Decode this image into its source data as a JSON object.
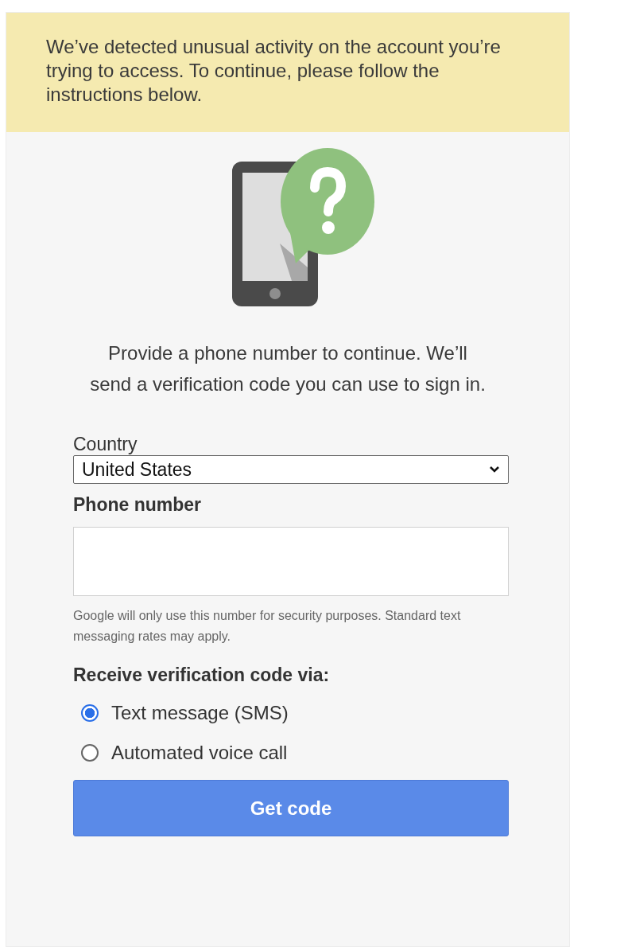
{
  "notice": "We’ve detected unusual activity on the account you’re trying to access. To continue, please follow the instructions below.",
  "prompt": "Provide a phone number to continue. We’ll send a verification code you can use to sign in.",
  "country": {
    "label": "Country",
    "value": "United States"
  },
  "phone": {
    "label": "Phone number"
  },
  "disclaimer": "Google will only use this number for security purposes. Standard text messaging rates may apply.",
  "method": {
    "heading": "Receive verification code via:",
    "options": [
      {
        "label": "Text message (SMS)",
        "selected": true
      },
      {
        "label": "Automated voice call",
        "selected": false
      }
    ]
  },
  "button": "Get code"
}
